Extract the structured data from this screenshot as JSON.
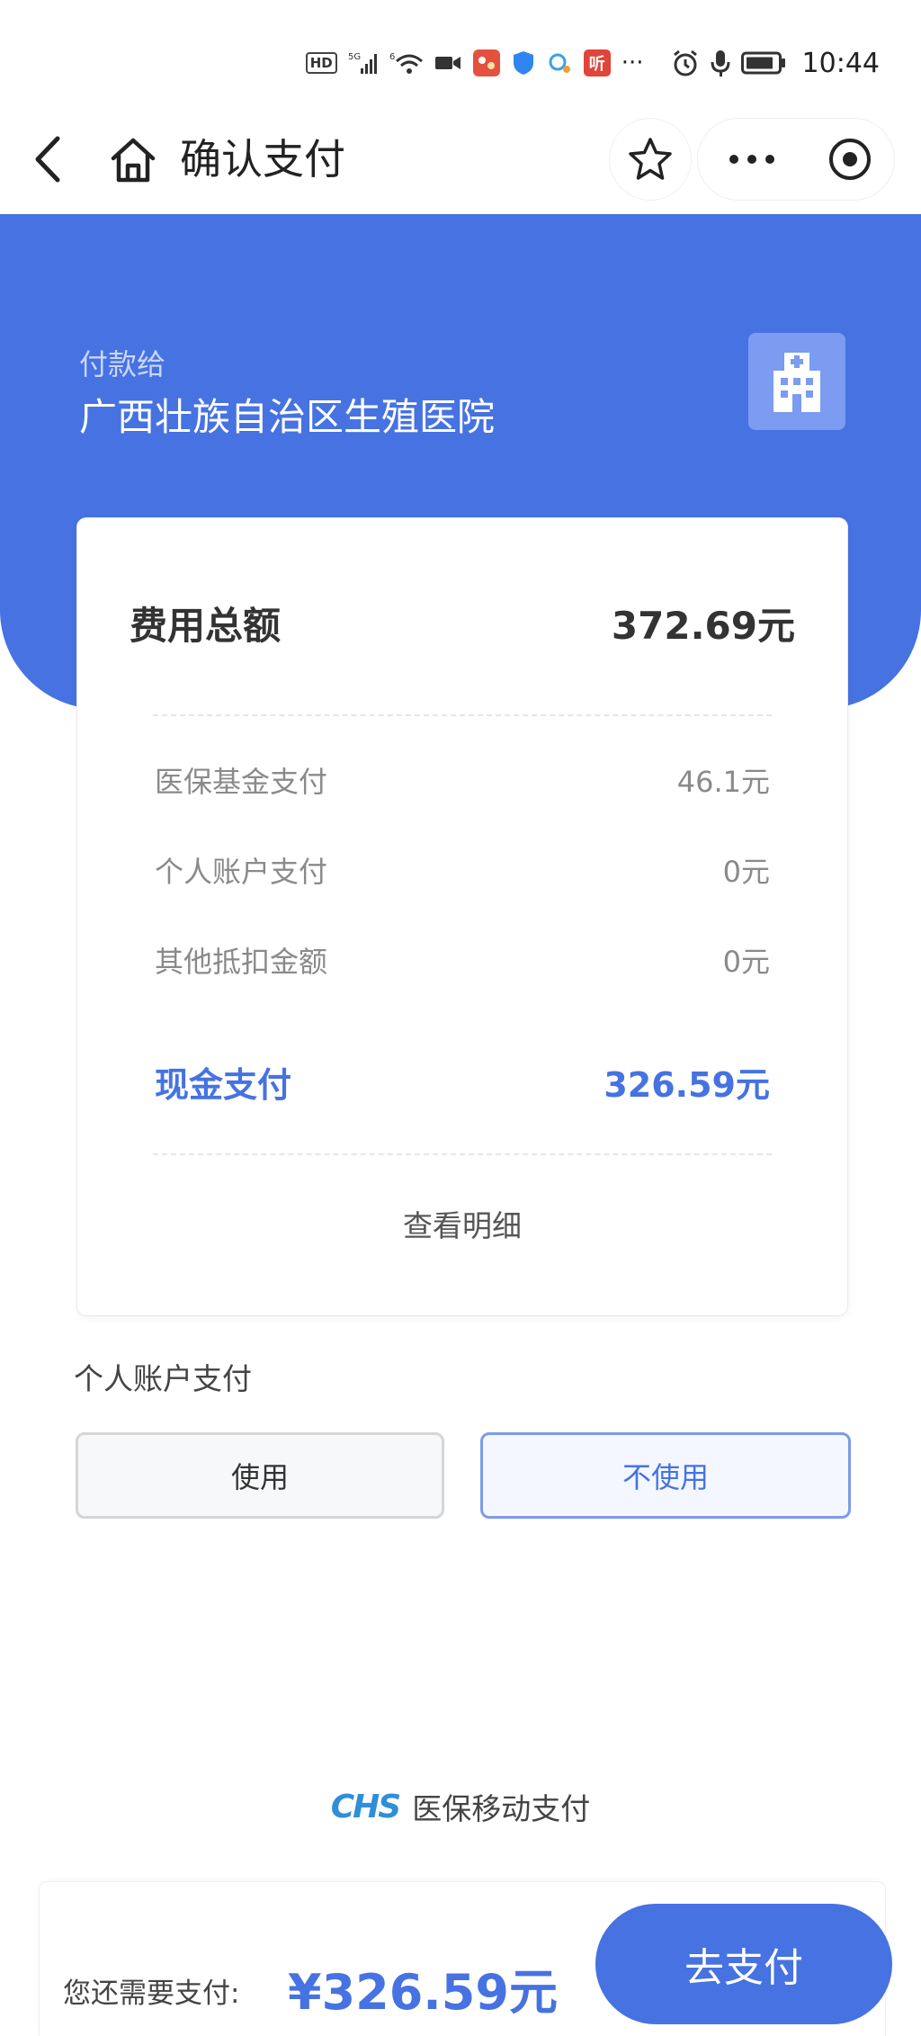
{
  "status_bar": {
    "hd": "HD",
    "net_label": "5G",
    "net_label_2": "6",
    "listen_label": "听",
    "more": "···",
    "time": "10:44"
  },
  "nav": {
    "title": "确认支付"
  },
  "header": {
    "pay_to_label": "付款给",
    "hospital_name": "广西壮族自治区生殖医院"
  },
  "summary": {
    "total_label": "费用总额",
    "total_value": "372.69元",
    "details": [
      {
        "label": "医保基金支付",
        "value": "46.1元"
      },
      {
        "label": "个人账户支付",
        "value": "0元"
      },
      {
        "label": "其他抵扣金额",
        "value": "0元"
      }
    ],
    "cash_label": "现金支付",
    "cash_value": "326.59元",
    "view_detail": "查看明细"
  },
  "personal_account": {
    "label": "个人账户支付",
    "options": [
      "使用",
      "不使用"
    ],
    "selected": "不使用"
  },
  "brand": {
    "logo": "CHS",
    "text": "医保移动支付"
  },
  "bottom": {
    "remaining_label": "您还需要支付:",
    "remaining_value": "¥326.59元",
    "pay_button": "去支付"
  },
  "colors": {
    "primary": "#4672e2",
    "header_blue": "#4672e2",
    "brand_logo": "#2f8fd8"
  },
  "icons": [
    "back-arrow-icon",
    "home-icon",
    "star-icon",
    "more-dots-icon",
    "close-target-icon",
    "hospital-building-icon"
  ]
}
